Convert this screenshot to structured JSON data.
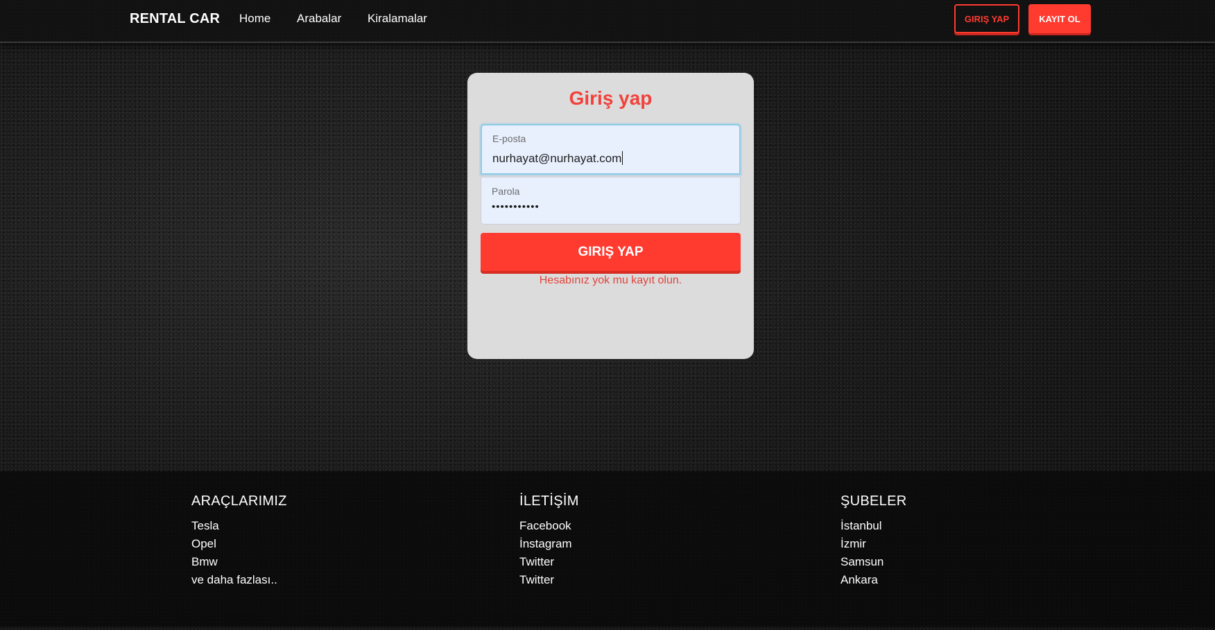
{
  "navbar": {
    "brand": "RENTAL CAR",
    "links": [
      "Home",
      "Arabalar",
      "Kiralamalar"
    ],
    "login_button": "GIRIŞ YAP",
    "register_button": "KAYIT OL"
  },
  "login": {
    "title": "Giriş yap",
    "email_label": "E-posta",
    "email_value": "nurhayat@nurhayat.com",
    "password_label": "Parola",
    "password_value": "•••••••••••",
    "submit_label": "GIRIŞ YAP",
    "register_link": "Hesabınız yok mu kayıt olun."
  },
  "footer": {
    "columns": [
      {
        "title": "ARAÇLARIMIZ",
        "items": [
          "Tesla",
          "Opel",
          "Bmw",
          "ve daha fazlası.."
        ]
      },
      {
        "title": "İLETİŞİM",
        "items": [
          "Facebook",
          "İnstagram",
          "Twitter",
          "Twitter"
        ]
      },
      {
        "title": "ŞUBELER",
        "items": [
          "İstanbul",
          "İzmir",
          "Samsun",
          "Ankara"
        ]
      }
    ]
  },
  "colors": {
    "accent": "#ff3b30",
    "card": "#dcdcdc",
    "input_bg": "#e8f0fe"
  }
}
